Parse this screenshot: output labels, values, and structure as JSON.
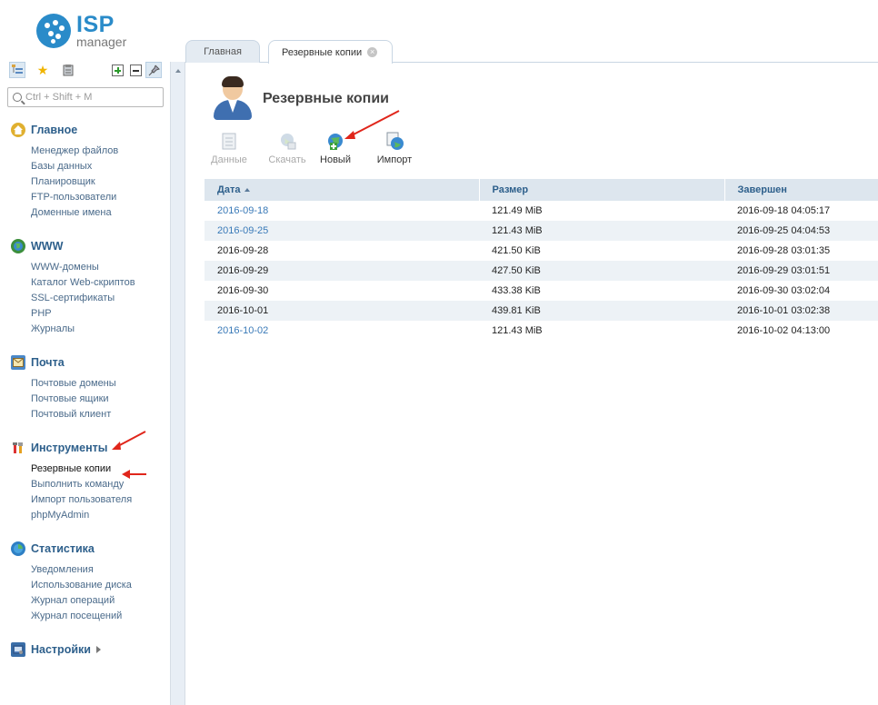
{
  "app": {
    "logo_main": "ISP",
    "logo_sub": "manager"
  },
  "sidebar": {
    "search_placeholder": "Ctrl + Shift + M",
    "sections": [
      {
        "title": "Главное",
        "icon": "home-icon",
        "items": [
          "Менеджер файлов",
          "Базы данных",
          "Планировщик",
          "FTP-пользователи",
          "Доменные имена"
        ]
      },
      {
        "title": "WWW",
        "icon": "globe-icon",
        "items": [
          "WWW-домены",
          "Каталог Web-скриптов",
          "SSL-сертификаты",
          "PHP",
          "Журналы"
        ]
      },
      {
        "title": "Почта",
        "icon": "mail-icon",
        "items": [
          "Почтовые домены",
          "Почтовые ящики",
          "Почтовый клиент"
        ]
      },
      {
        "title": "Инструменты",
        "icon": "tools-icon",
        "items": [
          "Резервные копии",
          "Выполнить команду",
          "Импорт пользователя",
          "phpMyAdmin"
        ]
      },
      {
        "title": "Статистика",
        "icon": "chart-icon",
        "items": [
          "Уведомления",
          "Использование диска",
          "Журнал операций",
          "Журнал посещений"
        ]
      },
      {
        "title": "Настройки",
        "icon": "settings-icon",
        "items": []
      }
    ],
    "active_item": "Резервные копии"
  },
  "tabs": [
    {
      "label": "Главная",
      "active": false
    },
    {
      "label": "Резервные копии",
      "active": true
    }
  ],
  "page": {
    "title": "Резервные копии",
    "actions": [
      {
        "label": "Данные",
        "enabled": false
      },
      {
        "label": "Скачать",
        "enabled": false
      },
      {
        "label": "Новый",
        "enabled": true
      },
      {
        "label": "Импорт",
        "enabled": true
      }
    ]
  },
  "table": {
    "columns": [
      "Дата",
      "Размер",
      "Завершен"
    ],
    "sort_column": "Дата",
    "rows": [
      {
        "date": "2016-09-18",
        "size": "121.49 MiB",
        "done": "2016-09-18 04:05:17",
        "link": true
      },
      {
        "date": "2016-09-25",
        "size": "121.43 MiB",
        "done": "2016-09-25 04:04:53",
        "link": true
      },
      {
        "date": "2016-09-28",
        "size": "421.50 KiB",
        "done": "2016-09-28 03:01:35",
        "link": false
      },
      {
        "date": "2016-09-29",
        "size": "427.50 KiB",
        "done": "2016-09-29 03:01:51",
        "link": false
      },
      {
        "date": "2016-09-30",
        "size": "433.38 KiB",
        "done": "2016-09-30 03:02:04",
        "link": false
      },
      {
        "date": "2016-10-01",
        "size": "439.81 KiB",
        "done": "2016-10-01 03:02:38",
        "link": false
      },
      {
        "date": "2016-10-02",
        "size": "121.43 MiB",
        "done": "2016-10-02 04:13:00",
        "link": true
      }
    ]
  },
  "colors": {
    "accent": "#2a8bc9",
    "nav_title": "#2d5f8b",
    "link": "#3a7ab8",
    "annotation": "#e0261b"
  }
}
